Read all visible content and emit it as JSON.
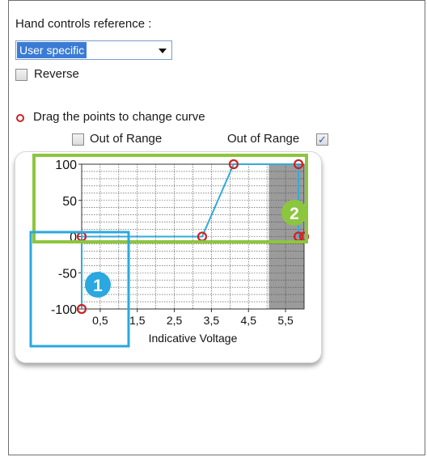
{
  "form": {
    "title": "Hand controls reference :",
    "reference_select_value": "User specific",
    "reverse_label": "Reverse",
    "reverse_checked": false,
    "hint_text": "Drag the points to change curve",
    "out_of_range_left_label": "Out of Range",
    "out_of_range_left_checked": false,
    "out_of_range_right_label": "Out of Range",
    "out_of_range_right_checked": true,
    "checkmark": "✓"
  },
  "chart_data": {
    "type": "line",
    "xlabel": "Indicative Voltage",
    "ylabel": "",
    "x_ticks": [
      "0,5",
      "1,5",
      "2,5",
      "3,5",
      "4,5",
      "5,5"
    ],
    "y_ticks": [
      "100",
      "50",
      "0",
      "-50",
      "-100"
    ],
    "xlim": [
      0,
      6
    ],
    "ylim": [
      -100,
      100
    ],
    "grid": true,
    "shaded_region_x": [
      5.05,
      6
    ],
    "series": [
      {
        "points": [
          [
            0,
            -100
          ],
          [
            0,
            0
          ],
          [
            3.25,
            0
          ],
          [
            4.1,
            100
          ],
          [
            5.85,
            100
          ],
          [
            5.85,
            0
          ],
          [
            6,
            0
          ]
        ]
      }
    ],
    "control_points": [
      [
        0,
        -100
      ],
      [
        0,
        0
      ],
      [
        3.25,
        0
      ],
      [
        4.1,
        100
      ],
      [
        5.85,
        100
      ],
      [
        5.85,
        0
      ],
      [
        6,
        0
      ]
    ]
  },
  "callouts": {
    "badge_1": "1",
    "badge_2": "2"
  },
  "colors": {
    "line": "#33aadd",
    "point": "#cc2222",
    "shade": "#9b9b9b",
    "callout_1": "#2aa8df",
    "callout_2": "#8cc63f"
  }
}
